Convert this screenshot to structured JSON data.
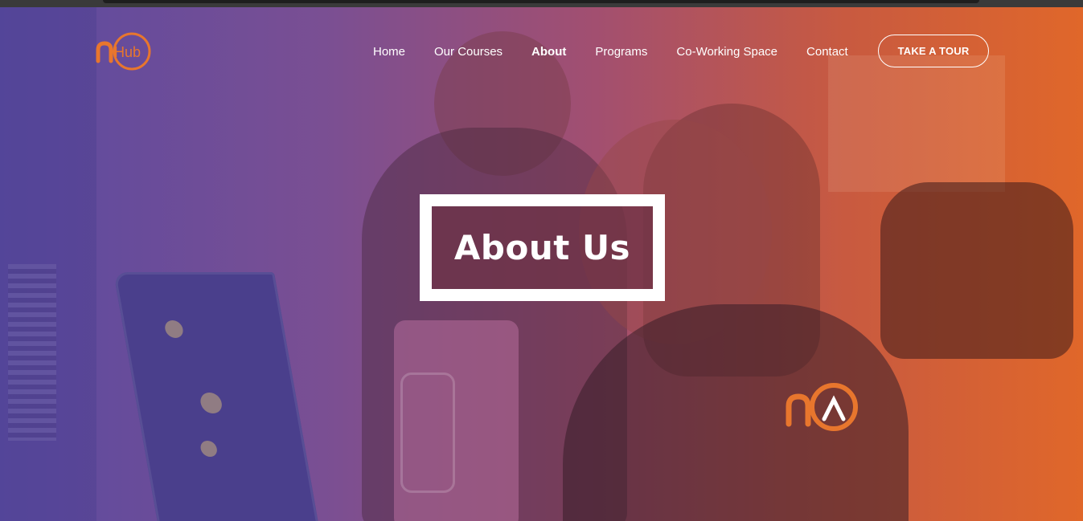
{
  "brand": {
    "logo_text": "nHub",
    "accent": "#e8762d"
  },
  "nav": {
    "items": [
      {
        "label": "Home",
        "active": false
      },
      {
        "label": "Our Courses",
        "active": false
      },
      {
        "label": "About",
        "active": true
      },
      {
        "label": "Programs",
        "active": false
      },
      {
        "label": "Co-Working Space",
        "active": false
      },
      {
        "label": "Contact",
        "active": false
      }
    ],
    "cta_label": "TAKE A TOUR"
  },
  "hero": {
    "title": "About Us",
    "gradient": [
      "#5b4aa0",
      "#e0672a"
    ]
  }
}
